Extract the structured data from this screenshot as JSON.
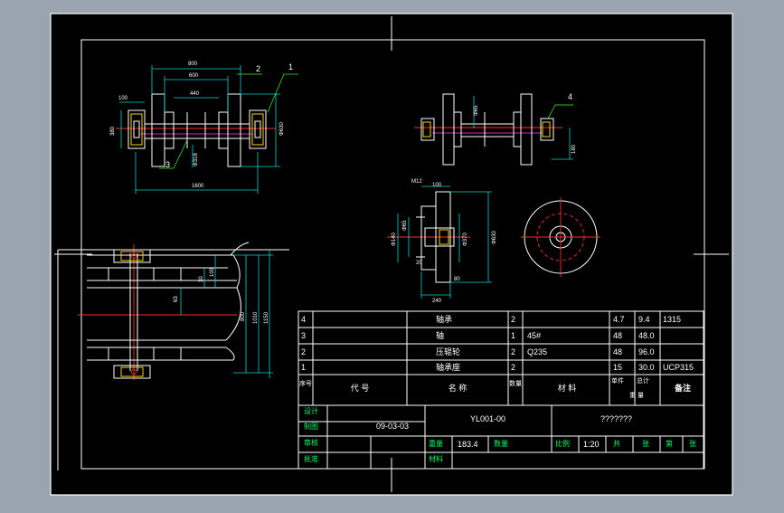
{
  "colors": {
    "background": "#9aa4b1",
    "paper": "#000000",
    "line": "#ffffff",
    "dimension": "#00d7d7",
    "center": "#ff2a2a",
    "extension": "#3aff3a"
  },
  "view_top": {
    "dims": [
      "800",
      "600",
      "440",
      "100",
      "380",
      "1600",
      "Φ630"
    ],
    "φ318": "Φ318",
    "labels": [
      "2",
      "1",
      "3"
    ]
  },
  "view_side": {
    "dims": [
      "Φ65",
      "180"
    ],
    "label": "4"
  },
  "view_section": {
    "dims": [
      "M12",
      "100",
      "Φ140",
      "Φ65",
      "Φ370",
      "Φ630",
      "20",
      "80",
      "240"
    ]
  },
  "view_plan": {
    "dims": [
      "100",
      "63",
      "30",
      "800",
      "1010",
      "1150"
    ]
  },
  "bom": [
    {
      "no": "4",
      "code": "",
      "name": "轴承",
      "qty": "2",
      "material": "",
      "unit": "4.7",
      "total": "9.4",
      "remark": "1315"
    },
    {
      "no": "3",
      "code": "",
      "name": "轴",
      "qty": "1",
      "material": "45#",
      "unit": "48",
      "total": "48.0",
      "remark": ""
    },
    {
      "no": "2",
      "code": "",
      "name": "压辊轮",
      "qty": "2",
      "material": "Q235",
      "unit": "48",
      "total": "96.0",
      "remark": ""
    },
    {
      "no": "1",
      "code": "",
      "name": "轴承座",
      "qty": "2",
      "material": "",
      "unit": "15",
      "total": "30.0",
      "remark": "UCP315"
    }
  ],
  "bom_header": {
    "no": "序号",
    "code": "代 号",
    "name": "名 称",
    "qty": "数量",
    "material": "材 料",
    "unit": "单件",
    "total": "总计",
    "weight": "重 量",
    "remark": "备注"
  },
  "title_block": {
    "row_labels": [
      "设计",
      "制图",
      "审核",
      "批准"
    ],
    "date": "09-03-03",
    "drawing_no": "YL001-00",
    "drawing_name": "???????",
    "weight_label": "重量",
    "weight_value": "183.4",
    "qty_label": "数量",
    "scale_label": "比例",
    "scale_value": "1:20",
    "sheet_a": "共",
    "sheet_b": "张",
    "sheet_c": "第",
    "sheet_d": "张",
    "material_label": "材料"
  }
}
